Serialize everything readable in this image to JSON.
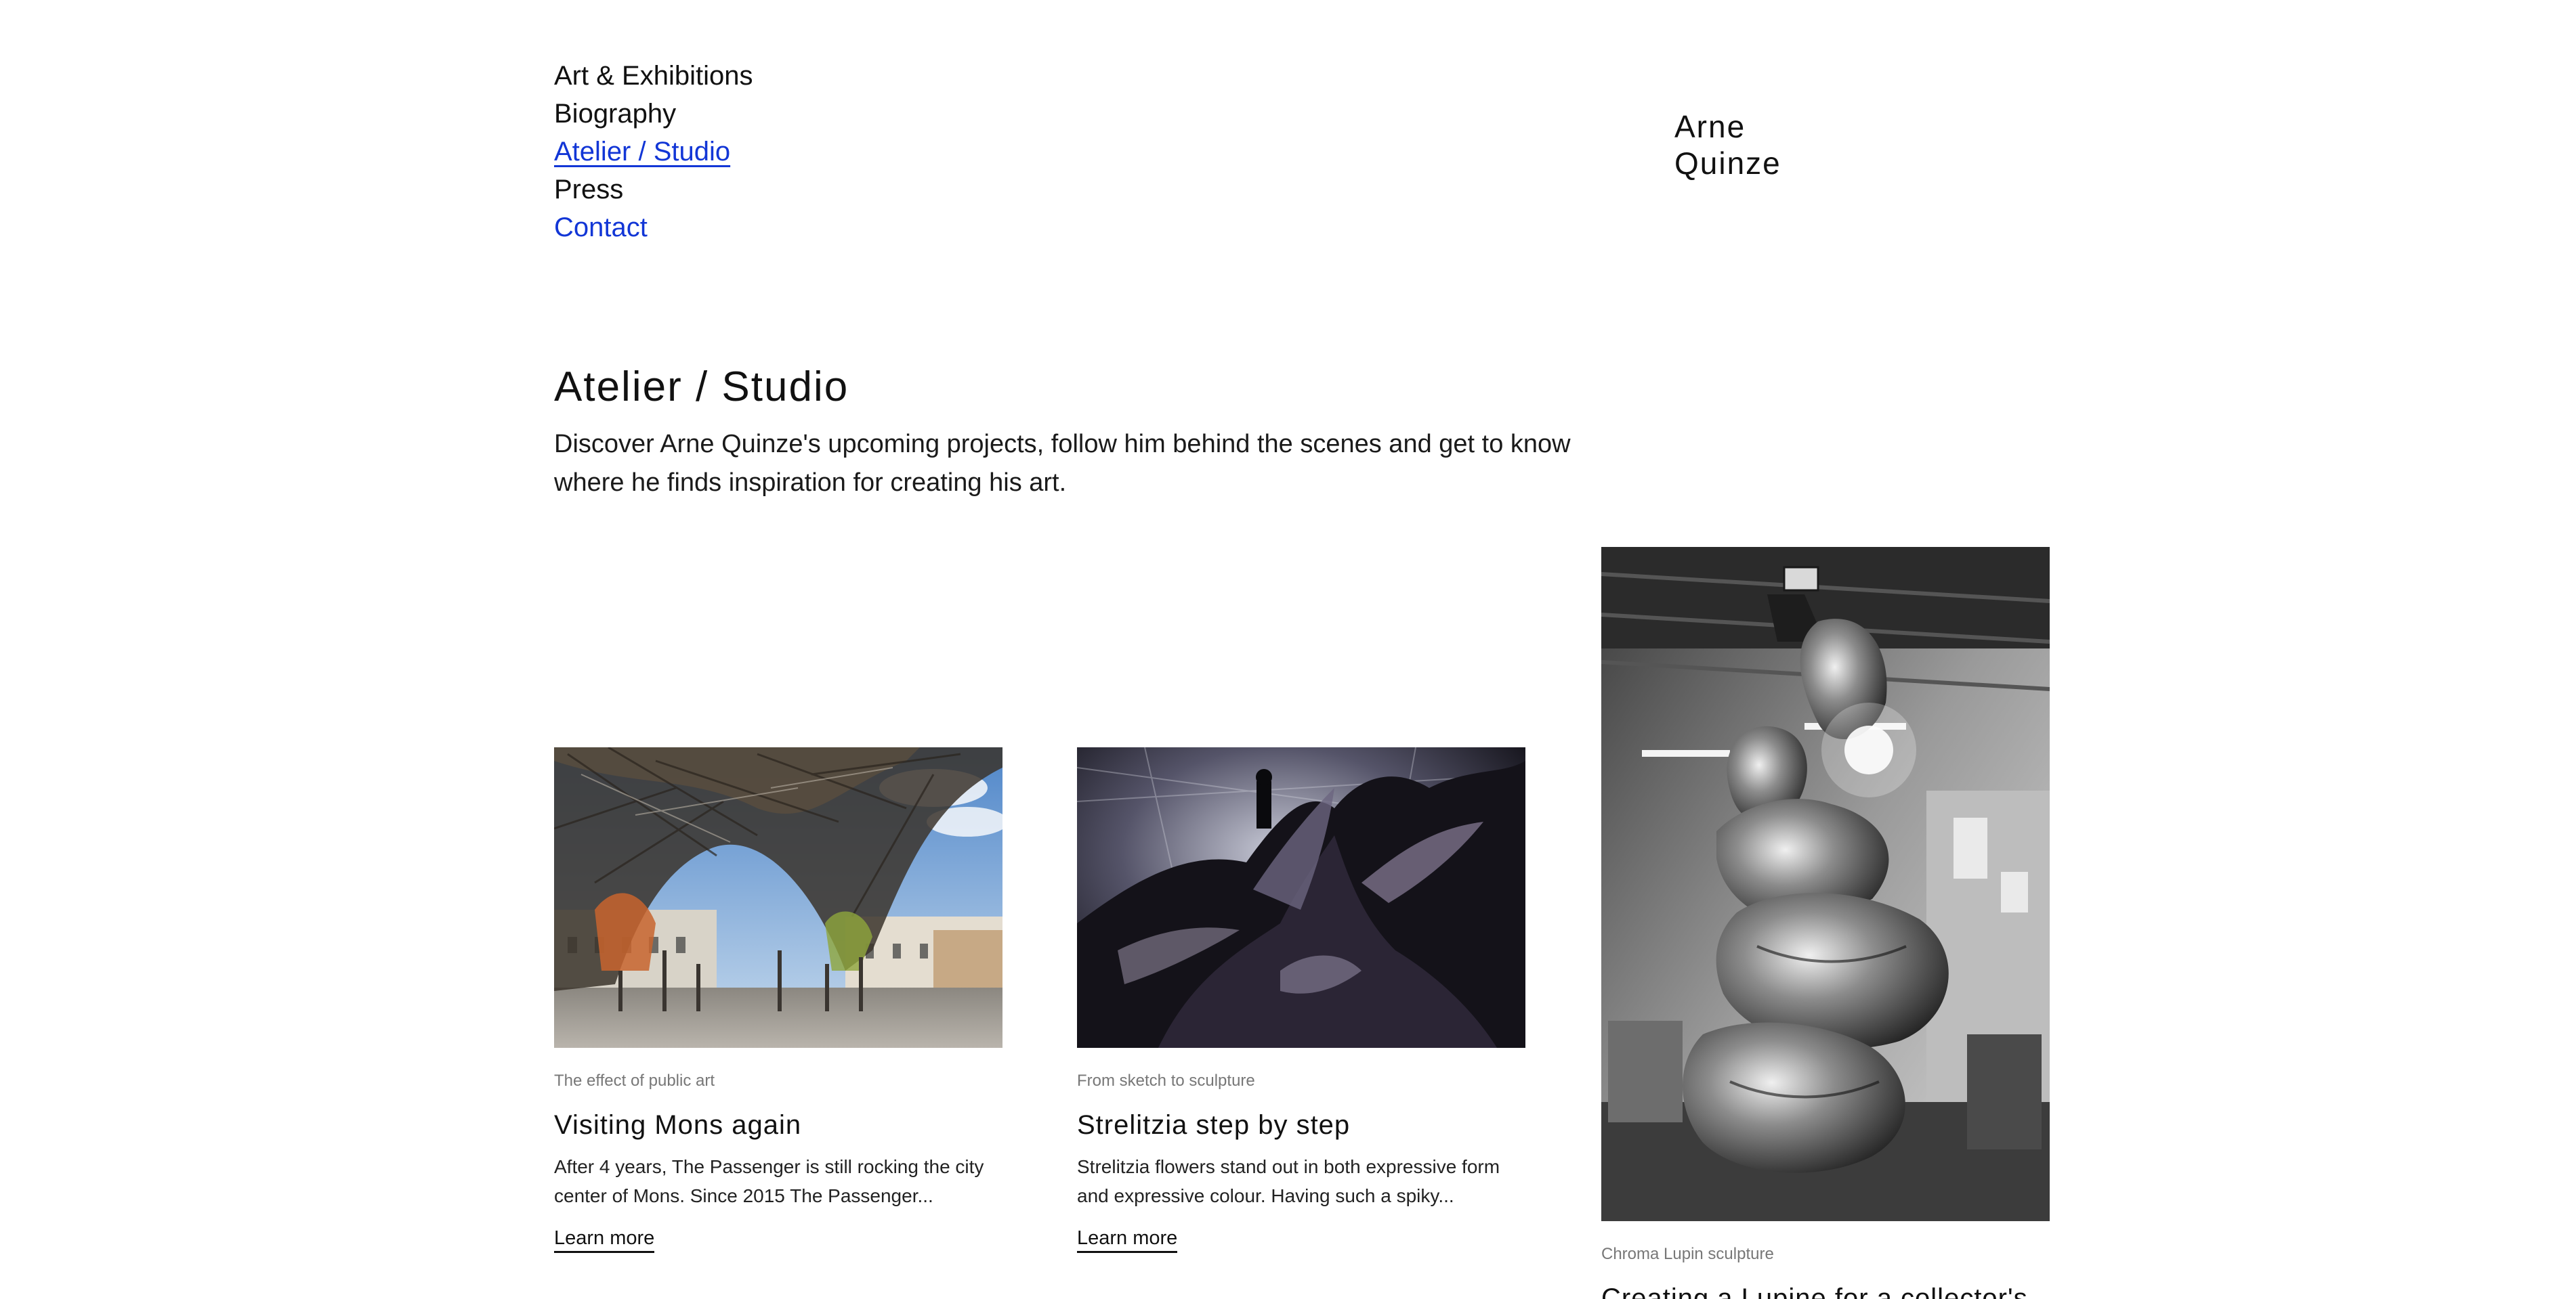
{
  "nav": {
    "items": [
      {
        "label": "Art & Exhibitions"
      },
      {
        "label": "Biography"
      },
      {
        "label": "Atelier / Studio"
      },
      {
        "label": "Press"
      },
      {
        "label": "Contact"
      }
    ]
  },
  "logo": {
    "line1": "Arne",
    "line2": "Quinze"
  },
  "page": {
    "title": "Atelier / Studio",
    "intro": "Discover Arne Quinze's upcoming projects, follow him behind the scenes and get to know where he finds inspiration for creating his art."
  },
  "cards": [
    {
      "category": "The effect of public art",
      "title": "Visiting Mons again",
      "excerpt": "After 4 years, The Passenger is still rocking the city center of Mons. Since 2015 The Passenger...",
      "link": "Learn more",
      "image": "wooden-installation-photo"
    },
    {
      "category": "From sketch to sculpture",
      "title": "Strelitzia step by step",
      "excerpt": "Strelitzia flowers stand out in both expressive form and expressive colour. Having such a spiky...",
      "link": "Learn more",
      "image": "dark-metal-sculpture-photo"
    },
    {
      "category": "Chroma Lupin sculpture",
      "title": "Creating a Lupine for a collector's",
      "image": "steel-sculpture-workshop-photo"
    }
  ],
  "colors": {
    "link_blue": "#1236d6",
    "text": "#111111",
    "muted": "#777777"
  }
}
